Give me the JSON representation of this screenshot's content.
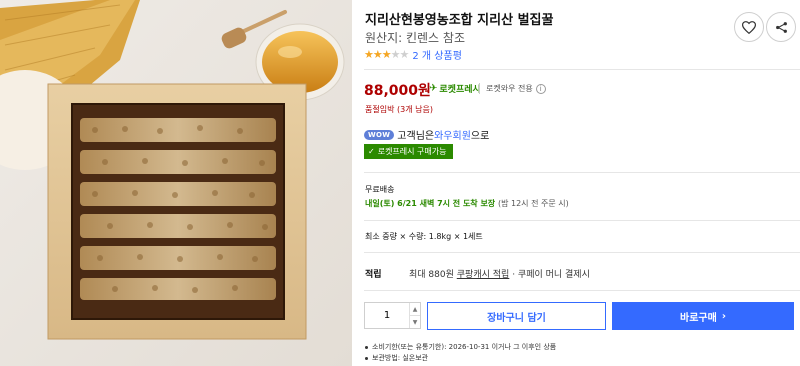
{
  "product": {
    "title": "지리산현봉영농조합 지리산 벌집꿀",
    "origin_label": "원산지: 킨렌스 참조",
    "rating_stars": 3,
    "rating_max": 5,
    "review_count": "2 개 상품평"
  },
  "price": {
    "value": "88,000원",
    "rocket_label": "로켓프레시",
    "rocketwow_label": "로켓와우 전용",
    "stock_notice": "품절임박 (3개 남음)"
  },
  "wow": {
    "badge": "WOW",
    "text_prefix": "고객님은 ",
    "member_label": "와우회원",
    "text_suffix": "으로",
    "rocket_buy_label": "로켓프레시 구매가능"
  },
  "shipping": {
    "free_label": "무료배송",
    "delivery_date": "내일(토) 6/21 새벽 7시 전 도착 보장",
    "delivery_condition": "(밤 12시 전 주문 시)"
  },
  "order": {
    "min_order": "최소 중량 × 수량: 1.8kg × 1세트"
  },
  "points": {
    "label": "적립",
    "max_text": "최대 880원",
    "cash_link": "쿠팡캐시 적립",
    "pay_text": "· 쿠페이 머니 결제시"
  },
  "purchase": {
    "quantity": "1",
    "cart_label": "장바구니 담기",
    "buy_label": "바로구매",
    "buy_arrow": "›"
  },
  "notes": [
    "소비기한(또는 유통기한): 2026-10-31 이거나 그 이후인 상품",
    "보관방법: 실온보관"
  ],
  "icons": {
    "heart": "heart-icon",
    "share": "share-icon"
  },
  "colors": {
    "price": "#ae0000",
    "rocket_green": "#2b8a00",
    "primary_blue": "#346aff"
  }
}
